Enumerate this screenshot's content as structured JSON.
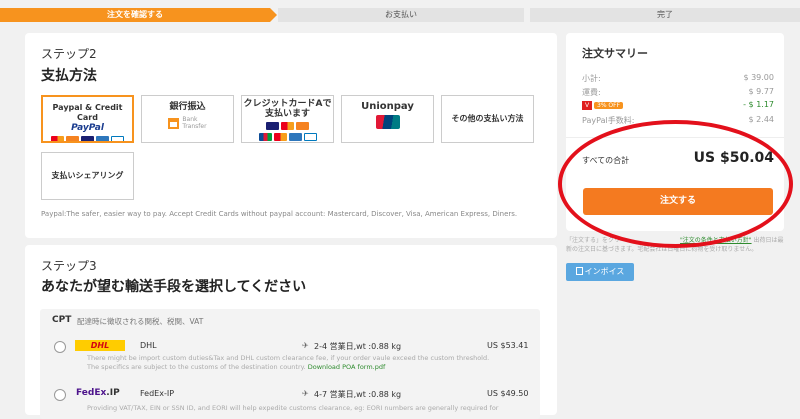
{
  "steps": {
    "confirm": "注文を確認する",
    "payment": "お支払い",
    "done": "完了"
  },
  "step2": {
    "label": "ステップ2",
    "title": "支払方法",
    "methods": [
      {
        "name": "Paypal & Credit Card",
        "sub": "PayPal"
      },
      {
        "name": "銀行振込",
        "sub1": "Bank",
        "sub2": "Transfer"
      },
      {
        "name": "クレジットカードAで支払います"
      },
      {
        "name": "Unionpay"
      },
      {
        "name": "その他の支払い方法"
      },
      {
        "name": "支払いシェアリング"
      }
    ],
    "note": "Paypal:The safer, easier way to pay. Accept Credit Cards without paypal account: Mastercard, Discover, Visa, American Express, Diners."
  },
  "step3": {
    "label": "ステップ3",
    "title": "あなたが望む輸送手段を選択してください",
    "cpt": {
      "code": "CPT",
      "desc": "配達時に徴収される関税、税関、VAT"
    },
    "options": [
      {
        "carrier": "DHL",
        "logo": "DHL",
        "eta": "2-4 営業日,wt :0.88 kg",
        "price": "US $53.41",
        "desc1": "There might be import custom duties&Tax and DHL custom clearance fee, if your order vaule exceed the custom threshold.",
        "desc2": "The specifics are subject to the customs of the destination country.",
        "link": "Download POA form.pdf"
      },
      {
        "carrier": "FedEx-IP",
        "logo_a": "FedEx",
        "logo_b": ".IP",
        "eta": "4-7 営業日,wt :0.88 kg",
        "price": "US $49.50",
        "desc1": "Providing VAT/TAX, EIN or SSN ID, and EORI will help expedite customs clearance, eg: EORI numbers are generally required for"
      }
    ]
  },
  "summary": {
    "title": "注文サマリー",
    "subtotal_label": "小計:",
    "subtotal": "$ 39.00",
    "shipping_label": "運費:",
    "shipping": "$ 9.77",
    "discount_badge": "3% OFF",
    "discount": "- $ 1.17",
    "paypal_fee_label": "PayPal手数料:",
    "paypal_fee": "$ 2.44",
    "total_label": "すべての合計",
    "total": "US $50.04",
    "order_button": "注文する"
  },
  "below_note": {
    "text1": "「注文する」をクリ",
    "text2": "出荷日は最新の注文日に基づきます。宅配会社は日曜日に荷物を受け取りません。",
    "link": "\"注文の条件と支払い方針\""
  },
  "invoice_button": "インボイス"
}
